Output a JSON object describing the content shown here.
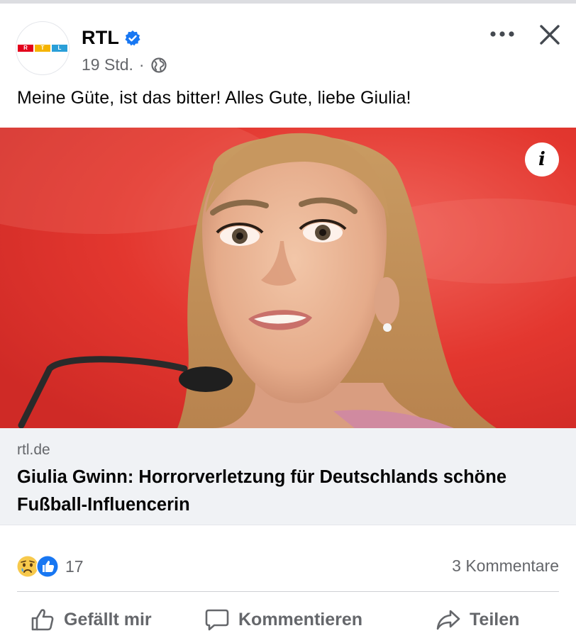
{
  "post": {
    "page_name": "RTL",
    "timestamp": "19 Std.",
    "separator": "·",
    "text": "Meine Güte, ist das bitter! Alles Gute, liebe Giulia!",
    "logo_letters": [
      "R",
      "T",
      "L"
    ],
    "verified": true
  },
  "link_preview": {
    "domain": "rtl.de",
    "title": "Giulia Gwinn: Horrorverletzung für Deutschlands schöne Fußball-Influencerin"
  },
  "engagement": {
    "reaction_count": "17",
    "reactions": [
      "sad",
      "like"
    ],
    "comments": "3 Kommentare"
  },
  "actions": {
    "like": "Gefällt mir",
    "comment": "Kommentieren",
    "share": "Teilen"
  },
  "colors": {
    "accent_blue": "#1877f2",
    "muted_text": "#65676b",
    "photo_background": "#e43a33",
    "logo_red": "#e3001b",
    "logo_yellow": "#f5b400",
    "logo_blue": "#2a9fd8"
  },
  "icons": {
    "verified": "verified-badge-icon",
    "privacy": "globe-icon",
    "more": "more-options-icon",
    "close": "close-icon",
    "info": "info-icon",
    "like": "thumbs-up-icon",
    "comment": "comment-bubble-icon",
    "share": "share-arrow-icon"
  }
}
